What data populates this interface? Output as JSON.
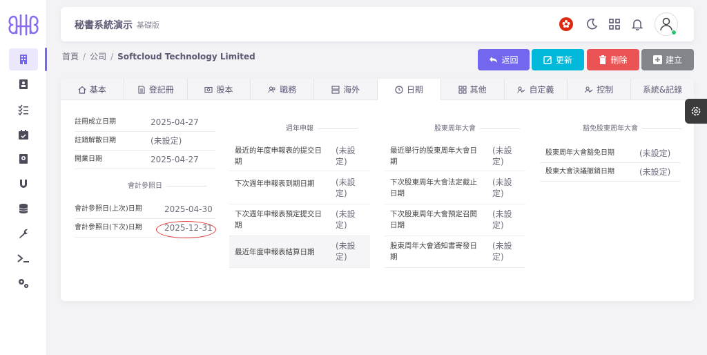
{
  "app": {
    "title": "秘書系統演示",
    "edition": "基礎版"
  },
  "breadcrumb": {
    "home": "首頁",
    "section": "公司",
    "current": "Softcloud Technology Limited"
  },
  "actions": {
    "back": "返回",
    "update": "更新",
    "delete": "刪除",
    "create": "建立"
  },
  "tabs": [
    {
      "label": "基本"
    },
    {
      "label": "登記冊"
    },
    {
      "label": "股本"
    },
    {
      "label": "職務"
    },
    {
      "label": "海外"
    },
    {
      "label": "日期"
    },
    {
      "label": "其他"
    },
    {
      "label": "自定義"
    },
    {
      "label": "控制"
    },
    {
      "label": "系統&記錄"
    }
  ],
  "dates": {
    "basic": [
      {
        "label": "註冊成立日期",
        "value": "2025-04-27"
      },
      {
        "label": "註銷解散日期",
        "value": "(未設定)"
      },
      {
        "label": "開業日期",
        "value": "2025-04-27"
      }
    ],
    "accounting_title": "會計參照日",
    "accounting": [
      {
        "label": "會計參照日(上次)日期",
        "value": "2025-04-30"
      },
      {
        "label": "會計參照日(下次)日期",
        "value": "2025-12-31"
      }
    ],
    "annual_return_title": "週年申報",
    "annual_return": [
      {
        "label1": "最近的年度申報表的提交日",
        "label2": "期",
        "value1": "(未設",
        "value2": "定)"
      },
      {
        "label1": "下次週年申報表到期日期",
        "label2": "",
        "value1": "(未設",
        "value2": "定)"
      },
      {
        "label1": "下次週年申報表預定提交日",
        "label2": "期",
        "value1": "(未設",
        "value2": "定)"
      },
      {
        "label1": "最近年度申報表結算日期",
        "label2": "",
        "value1": "(未設",
        "value2": "定)"
      }
    ],
    "agm_title": "股東周年大會",
    "agm": [
      {
        "label1": "最近舉行的股東周年大會日",
        "label2": "期",
        "value1": "(未設",
        "value2": "定)"
      },
      {
        "label1": "下次股東周年大會法定截止",
        "label2": "日期",
        "value1": "(未設",
        "value2": "定)"
      },
      {
        "label1": "下次股東周年大會預定召開",
        "label2": "日期",
        "value1": "(未設",
        "value2": "定)"
      },
      {
        "label1": "股東周年大會通知書寄發日",
        "label2": "期",
        "value1": "(未設",
        "value2": "定)"
      }
    ],
    "agm_exempt_title": "豁免股東周年大會",
    "agm_exempt": [
      {
        "label": "股東周年大會豁免日期",
        "value": "(未設定)"
      },
      {
        "label": "股東大會決議撤銷日期",
        "value": "(未設定)"
      }
    ]
  },
  "colors": {
    "primary": "#7367f0",
    "info": "#00b8d9",
    "danger": "#ea5455",
    "secondary": "#82868b",
    "hk_flag": "#de2910"
  }
}
